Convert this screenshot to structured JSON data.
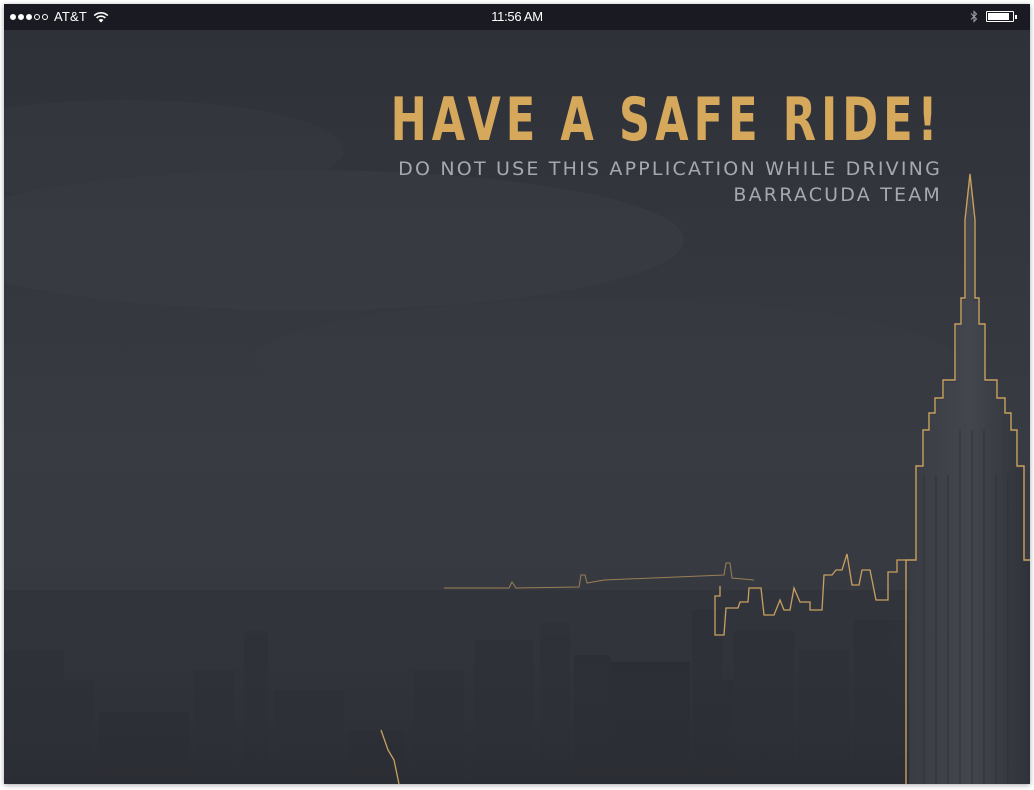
{
  "status_bar": {
    "carrier": "AT&T",
    "signal_bars_filled": 3,
    "signal_bars_total": 5,
    "wifi_icon": "wifi-icon",
    "time": "11:56 AM",
    "bluetooth_icon": "bluetooth-icon",
    "battery_level": 0.9
  },
  "message": {
    "headline": "HAVE A SAFE RIDE!",
    "warning": "DO NOT USE THIS APPLICATION WHILE DRIVING",
    "signature": "BARRACUDA TEAM"
  },
  "colors": {
    "accent_gold": "#d6a85c",
    "background": "#33353d",
    "status_bar": "#1a1b22",
    "subtext": "#a7a8ae"
  }
}
